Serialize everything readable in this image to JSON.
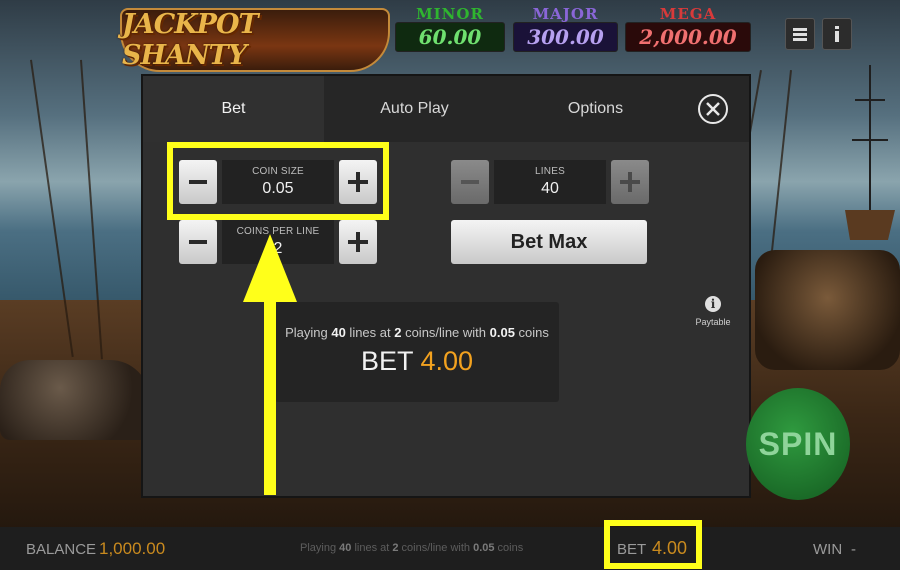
{
  "game": {
    "logo_text": "JACKPOT SHANTY"
  },
  "jackpots": [
    {
      "label": "MINOR",
      "value": "60.00"
    },
    {
      "label": "MAJOR",
      "value": "300.00"
    },
    {
      "label": "MEGA",
      "value": "2,000.00"
    }
  ],
  "top_controls": {
    "menu_icon": "hamburger-menu-icon",
    "info_icon": "info-icon"
  },
  "modal": {
    "tabs": [
      {
        "label": "Bet",
        "active": true
      },
      {
        "label": "Auto Play",
        "active": false
      },
      {
        "label": "Options",
        "active": false
      }
    ],
    "coin_size": {
      "label": "COIN SIZE",
      "value": "0.05"
    },
    "coins_per_line": {
      "label": "COINS PER LINE",
      "value": "2"
    },
    "lines": {
      "label": "LINES",
      "value": "40"
    },
    "bet_max_label": "Bet Max",
    "paytable_label": "Paytable",
    "summary": {
      "prefix": "Playing ",
      "lines": "40",
      "mid1": " lines at ",
      "coins": "2",
      "mid2": " coins/line with ",
      "coin_size": "0.05",
      "suffix": " coins",
      "bet_label": "BET",
      "bet_value": "4.00"
    }
  },
  "spin_label": "SPIN",
  "bottom_bar": {
    "balance_label": "BALANCE",
    "balance_value": "1,000.00",
    "info_prefix": "Playing ",
    "info_lines": "40",
    "info_mid1": " lines at ",
    "info_coins": "2",
    "info_mid2": " coins/line with ",
    "info_coin_size": "0.05",
    "info_suffix": " coins",
    "bet_label": "BET",
    "bet_value": "4.00",
    "win_label": "WIN",
    "win_value": "-"
  },
  "colors": {
    "highlight": "#ffff1a",
    "accent": "#f3a21f",
    "spin": "#2f9a3f"
  }
}
